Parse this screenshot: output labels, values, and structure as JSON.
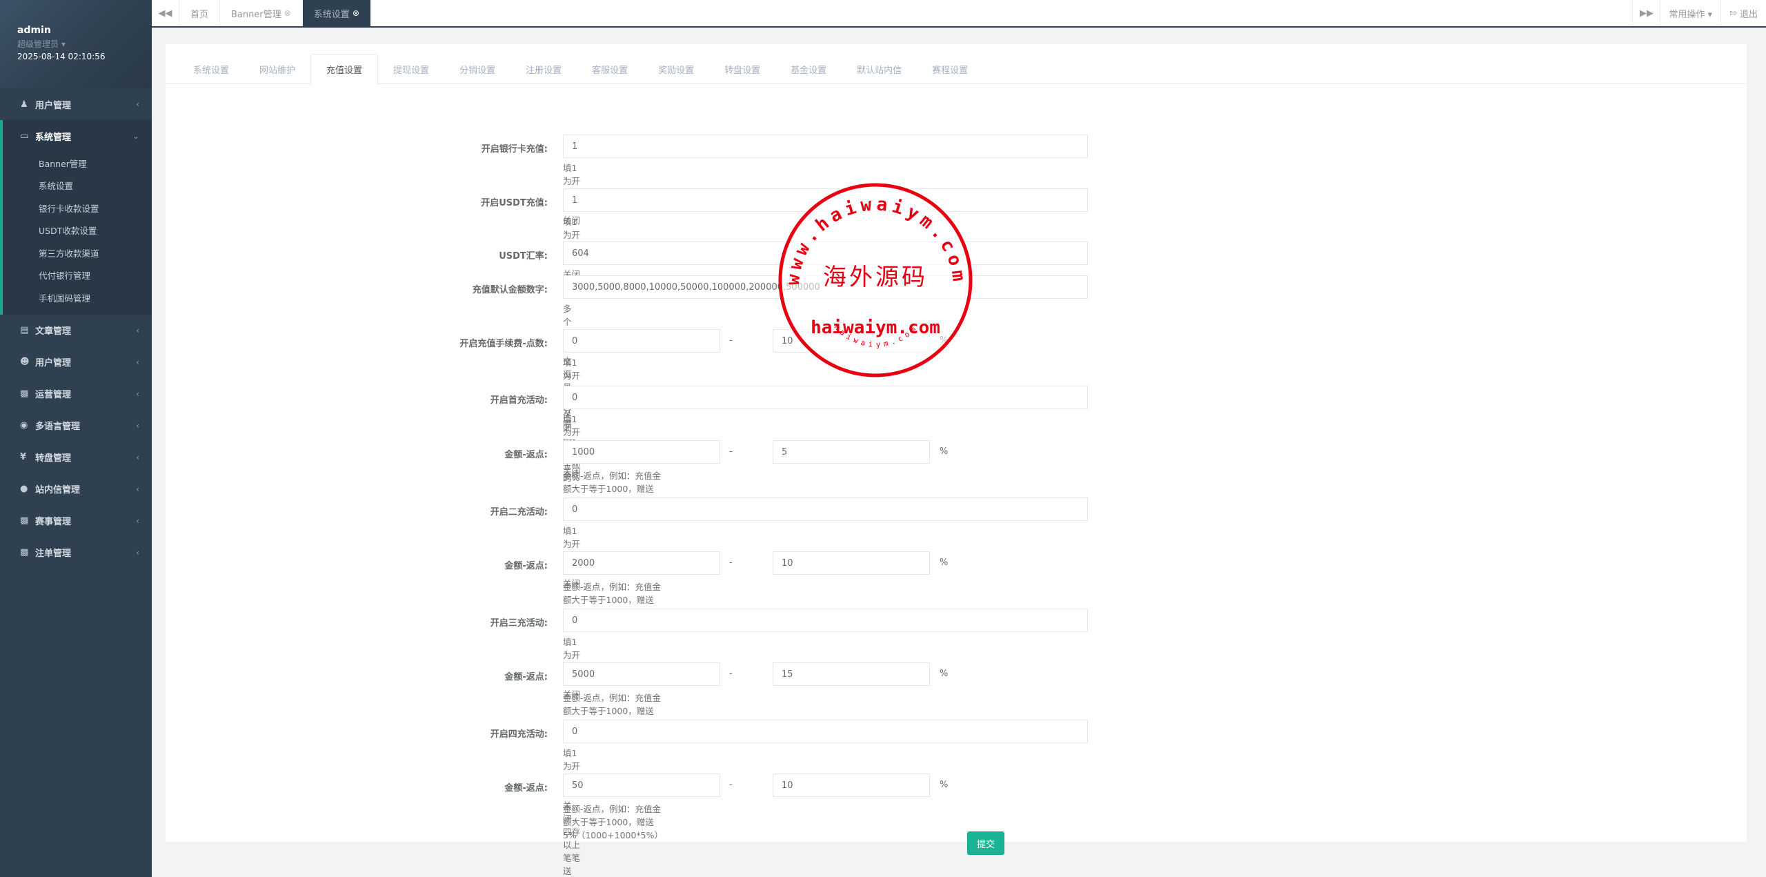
{
  "profile": {
    "username": "admin",
    "role": "超级管理员 ▾",
    "time": "2025-08-14 02:10:56"
  },
  "sidebar": {
    "items_top": [
      {
        "label": "用户管理"
      }
    ],
    "active_group": {
      "label": "系统管理",
      "children": [
        "Banner管理",
        "系统设置",
        "银行卡收款设置",
        "USDT收款设置",
        "第三方收款渠道",
        "代付银行管理",
        "手机国码管理"
      ]
    },
    "items_bottom": [
      {
        "label": "文章管理"
      },
      {
        "label": "用户管理"
      },
      {
        "label": "运营管理"
      },
      {
        "label": "多语言管理"
      },
      {
        "label": "转盘管理"
      },
      {
        "label": "站内信管理"
      },
      {
        "label": "赛事管理"
      },
      {
        "label": "注单管理"
      }
    ]
  },
  "topbar": {
    "tabs": [
      {
        "label": "首页"
      },
      {
        "label": "Banner管理"
      },
      {
        "label": "系统设置"
      }
    ],
    "common_ops": "常用操作 ▾",
    "logout": "退出"
  },
  "settings_tabs": [
    "系统设置",
    "网站维护",
    "充值设置",
    "提现设置",
    "分销设置",
    "注册设置",
    "客服设置",
    "奖励设置",
    "转盘设置",
    "基金设置",
    "默认站内信",
    "赛程设置"
  ],
  "form": {
    "bank_recharge": {
      "label": "开启银行卡充值:",
      "value": "1",
      "help": "填1为开启，0为关闭"
    },
    "usdt_recharge": {
      "label": "开启USDT充值:",
      "value": "1",
      "help": "填1为开启，0为关闭"
    },
    "usdt_rate": {
      "label": "USDT汇率:",
      "value": "604"
    },
    "default_amounts": {
      "label": "充值默认金额数字:",
      "value": "3000,5000,8000,10000,50000,100000,200000,500000",
      "help": "多个用英文逗号[,]分隔"
    },
    "fee": {
      "label": "开启充值手续费-点数:",
      "value1": "0",
      "value2": "10",
      "sep": "-",
      "unit": "%",
      "help": "填1为开启，0为关闭------充值金额的%"
    },
    "first_activity": {
      "label": "开启首充活动:",
      "value": "0",
      "help": "填1为开启，0为关闭"
    },
    "first_rebate": {
      "label": "金额-返点:",
      "value1": "1000",
      "value2": "5",
      "sep": "-",
      "unit": "%",
      "help": "金额-返点，例如：充值金额大于等于1000，赠送5%（1000+1000*5%）"
    },
    "second_activity": {
      "label": "开启二充活动:",
      "value": "0",
      "help": "填1为开启，0为关闭"
    },
    "second_rebate": {
      "label": "金额-返点:",
      "value1": "2000",
      "value2": "10",
      "sep": "-",
      "unit": "%",
      "help": "金额-返点，例如：充值金额大于等于1000，赠送5%（1000+1000*5%）"
    },
    "third_activity": {
      "label": "开启三充活动:",
      "value": "0",
      "help": "填1为开启，0为关闭"
    },
    "third_rebate": {
      "label": "金额-返点:",
      "value1": "5000",
      "value2": "15",
      "sep": "-",
      "unit": "%",
      "help": "金额-返点，例如：充值金额大于等于1000，赠送5%（1000+1000*5%）"
    },
    "fourth_activity": {
      "label": "开启四充活动:",
      "value": "0",
      "help": "填1为开启，0为关闭，四存以上笔笔送"
    },
    "fourth_rebate": {
      "label": "金额-返点:",
      "value1": "50",
      "value2": "10",
      "sep": "-",
      "unit": "%",
      "help": "金额-返点，例如：充值金额大于等于1000，赠送5%（1000+1000*5%）"
    },
    "submit": "提交"
  },
  "watermark": {
    "arc_text": "www.haiwaiym.com",
    "center_text": "海外源码",
    "domain_text": "haiwaiym.com",
    "small_text": "haiwaiym.com",
    "color": "#e60012"
  },
  "colors": {
    "sidebar": "#2f4050",
    "accent": "#1ab394"
  }
}
